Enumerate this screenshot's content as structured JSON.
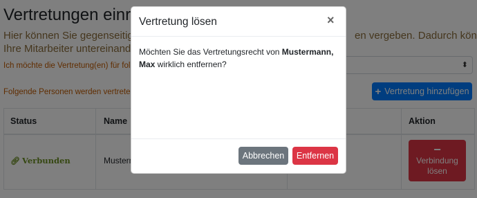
{
  "page": {
    "title": "Vertretungen einric",
    "desc_line1_left": "Hier können Sie gegenseitige",
    "desc_line1_right": "en vergeben. Dadurch können",
    "desc_line2_left": "Ihre Mitarbeiter untereinande",
    "select_label": "Ich möchte die Vertretung(en) für folg",
    "select_arrow_icon": "updown-chevron-icon",
    "persons_label": "Folgende Personen werden vertreten",
    "add_button": {
      "label": "Vertretung hinzufügen",
      "icon": "plus-icon"
    }
  },
  "table": {
    "headers": {
      "status": "Status",
      "name": "Name",
      "action": "Aktion"
    },
    "rows": [
      {
        "status": "Verbunden",
        "status_icon": "link-icon",
        "name": "Musterm",
        "action_label": "Verbindung lösen",
        "action_icon": "minus-icon"
      }
    ]
  },
  "modal": {
    "title": "Vertretung lösen",
    "close_label": "×",
    "body_before": "Möchten Sie das Vertretungsrecht von ",
    "body_bold": "Mustermann, Max",
    "body_after": " wirklich entfernen?",
    "cancel_label": "Abbrechen",
    "remove_label": "Entfernen"
  },
  "colors": {
    "primary": "#007bff",
    "danger": "#dc3545",
    "secondary": "#6c757d",
    "status_green": "#6b8e23",
    "label_orange": "#c05a00"
  }
}
